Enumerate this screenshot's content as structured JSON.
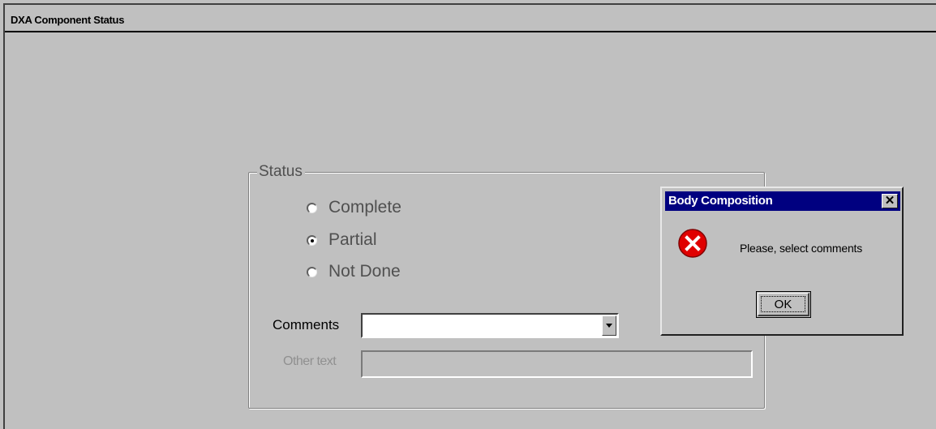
{
  "window": {
    "title": "DXA Component Status"
  },
  "status_group": {
    "legend": "Status",
    "options": [
      {
        "label": "Complete",
        "checked": false
      },
      {
        "label": "Partial",
        "checked": true
      },
      {
        "label": "Not Done",
        "checked": false
      }
    ]
  },
  "comments": {
    "label": "Comments",
    "value": ""
  },
  "other_text": {
    "label": "Other text",
    "value": "",
    "enabled": false
  },
  "dialog": {
    "title": "Body Composition",
    "close_glyph": "✕",
    "message": "Please, select comments",
    "ok_label": "OK",
    "icon": "error-icon",
    "titlebar_color": "#000080",
    "icon_color": "#e00000"
  }
}
